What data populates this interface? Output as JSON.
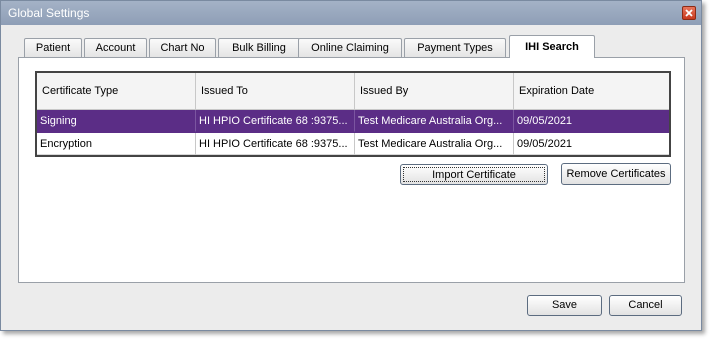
{
  "window": {
    "title": "Global Settings"
  },
  "tabs": [
    {
      "label": "Patient"
    },
    {
      "label": "Account"
    },
    {
      "label": "Chart No"
    },
    {
      "label": "Bulk Billing"
    },
    {
      "label": "Online Claiming"
    },
    {
      "label": "Payment Types"
    },
    {
      "label": "IHI Search",
      "active": true
    }
  ],
  "grid": {
    "columns": [
      "Certificate Type",
      "Issued To",
      "Issued By",
      "Expiration Date"
    ],
    "rows": [
      {
        "type": "Signing",
        "issued_to": "HI HPIO Certificate 68 :9375...",
        "issued_by": "Test Medicare Australia Org...",
        "expiration": "09/05/2021",
        "selected": true
      },
      {
        "type": "Encryption",
        "issued_to": "HI HPIO Certificate 68 :9375...",
        "issued_by": "Test Medicare Australia Org...",
        "expiration": "09/05/2021",
        "selected": false
      }
    ]
  },
  "buttons": {
    "import": "Import Certificate",
    "remove": "Remove Certificates",
    "save": "Save",
    "cancel": "Cancel"
  },
  "colors": {
    "titlebar": "#a4b2c6",
    "selection": "#5b2d86"
  },
  "icons": {
    "close": "close-icon"
  }
}
